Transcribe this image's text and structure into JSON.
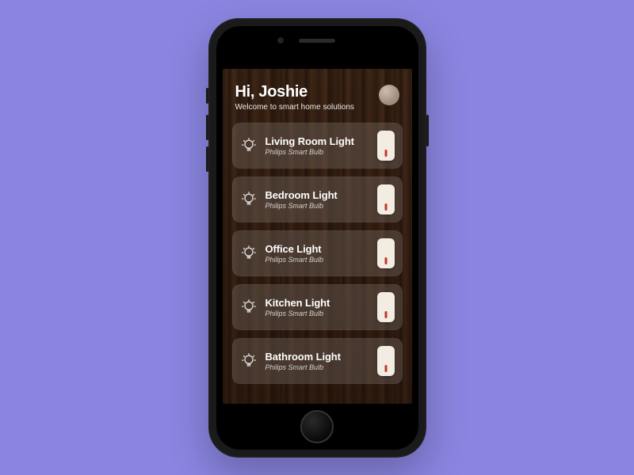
{
  "header": {
    "greeting": "Hi, Joshie",
    "subtitle": "Welcome to smart home solutions"
  },
  "devices": [
    {
      "name": "Living Room Light",
      "sub": "Philips Smart Bulb"
    },
    {
      "name": "Bedroom Light",
      "sub": "Philips Smart Bulb"
    },
    {
      "name": "Office Light",
      "sub": "Philips Smart Bulb"
    },
    {
      "name": "Kitchen Light",
      "sub": "Philips Smart Bulb"
    },
    {
      "name": "Bathroom Light",
      "sub": "Philips Smart Bulb"
    }
  ]
}
